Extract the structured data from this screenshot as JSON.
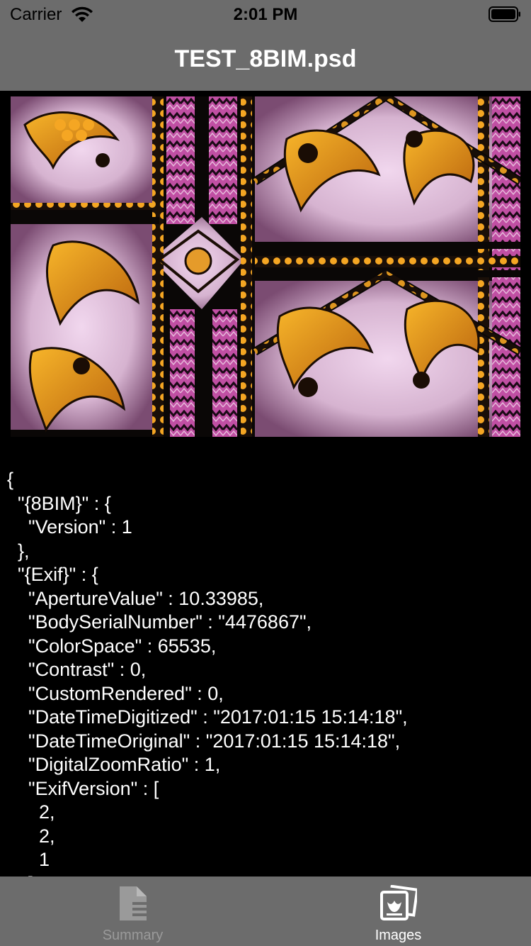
{
  "status_bar": {
    "carrier": "Carrier",
    "time": "2:01 PM"
  },
  "nav": {
    "title": "TEST_8BIM.psd"
  },
  "image": {
    "description_icon": "stained-glass-photo"
  },
  "metadata_lines": [
    "{",
    "  \"{8BIM}\" : {",
    "    \"Version\" : 1",
    "  },",
    "  \"{Exif}\" : {",
    "    \"ApertureValue\" : 10.33985,",
    "    \"BodySerialNumber\" : \"4476867\",",
    "    \"ColorSpace\" : 65535,",
    "    \"Contrast\" : 0,",
    "    \"CustomRendered\" : 0,",
    "    \"DateTimeDigitized\" : \"2017:01:15 15:14:18\",",
    "    \"DateTimeOriginal\" : \"2017:01:15 15:14:18\",",
    "    \"DigitalZoomRatio\" : 1,",
    "    \"ExifVersion\" : [",
    "      2,",
    "      2,",
    "      1",
    "    ],"
  ],
  "tabs": [
    {
      "label": "Summary",
      "icon": "document-icon",
      "selected": false
    },
    {
      "label": "Images",
      "icon": "photos-icon",
      "selected": true
    }
  ],
  "colors": {
    "bar_background": "#6c6c6c",
    "selected_tab": "#ffffff",
    "unselected_tab": "#9a9a9a"
  }
}
